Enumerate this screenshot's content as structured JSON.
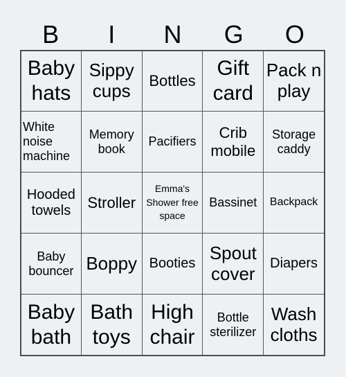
{
  "header": [
    "B",
    "I",
    "N",
    "G",
    "O"
  ],
  "cells": [
    [
      "Baby hats",
      "Sippy cups",
      "Bottles",
      "Gift card",
      "Pack n play"
    ],
    [
      "White noise machine",
      "Memory book",
      "Pacifiers",
      "Crib mobile",
      "Storage caddy"
    ],
    [
      "Hooded towels",
      "Stroller",
      "Emma's Shower free space",
      "Bassinet",
      "Backpack"
    ],
    [
      "Baby bouncer",
      "Boppy",
      "Booties",
      "Spout cover",
      "Diapers"
    ],
    [
      "Baby bath",
      "Bath toys",
      "High chair",
      "Bottle sterilizer",
      "Wash cloths"
    ]
  ]
}
